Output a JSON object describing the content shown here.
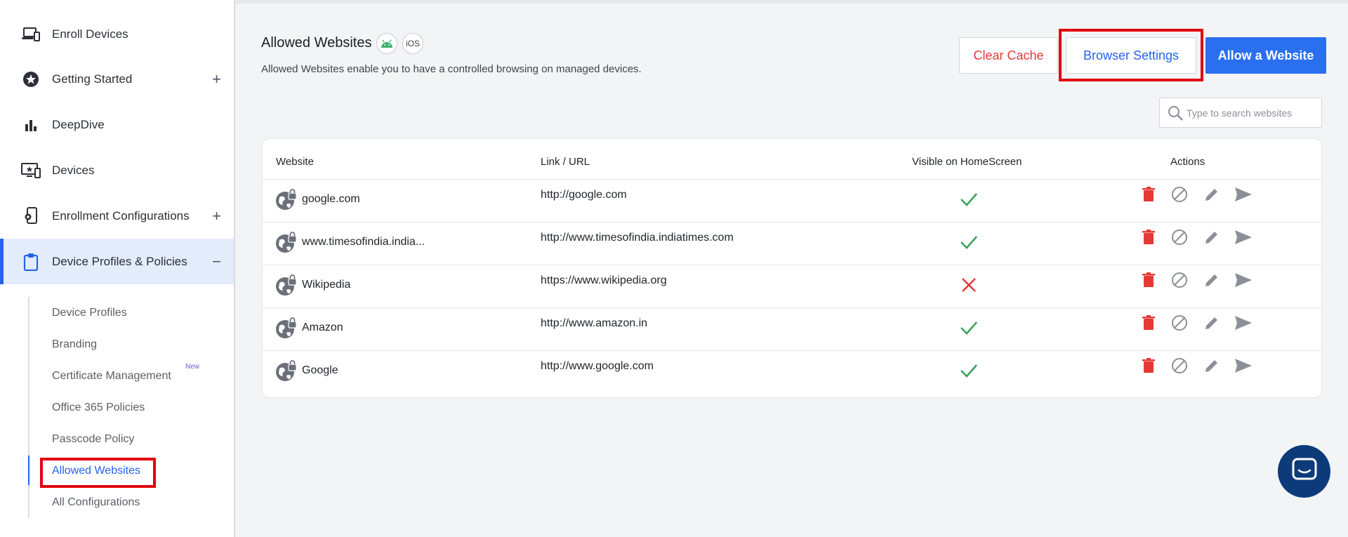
{
  "sidebar": {
    "items": [
      {
        "label": "Enroll Devices",
        "icon": "devices-icon",
        "toggle": ""
      },
      {
        "label": "Getting Started",
        "icon": "star-badge-icon",
        "toggle": "+"
      },
      {
        "label": "DeepDive",
        "icon": "bar-chart-icon",
        "toggle": ""
      },
      {
        "label": "Devices",
        "icon": "monitor-icon",
        "toggle": ""
      },
      {
        "label": "Enrollment Configurations",
        "icon": "phone-config-icon",
        "toggle": "+"
      },
      {
        "label": "Device Profiles & Policies",
        "icon": "clipboard-icon",
        "toggle": "−"
      }
    ],
    "sub_items": [
      {
        "label": "Device Profiles"
      },
      {
        "label": "Branding"
      },
      {
        "label": "Certificate Management",
        "badge": "New"
      },
      {
        "label": "Office 365 Policies"
      },
      {
        "label": "Passcode Policy"
      },
      {
        "label": "Allowed Websites"
      },
      {
        "label": "All Configurations"
      }
    ]
  },
  "header": {
    "title": "Allowed Websites",
    "ios_badge": "iOS",
    "subtitle": "Allowed Websites enable you to have a controlled browsing on managed devices."
  },
  "toolbar": {
    "clear_cache": "Clear Cache",
    "browser_settings": "Browser Settings",
    "allow_website": "Allow a Website"
  },
  "search": {
    "placeholder": "Type to search websites"
  },
  "table": {
    "columns": [
      "Website",
      "Link / URL",
      "Visible on HomeScreen",
      "Actions"
    ],
    "rows": [
      {
        "website": "google.com",
        "url": "http://google.com",
        "visible": true
      },
      {
        "website": "www.timesofindia.india...",
        "url": "http://www.timesofindia.indiatimes.com",
        "visible": true
      },
      {
        "website": "Wikipedia",
        "url": "https://www.wikipedia.org",
        "visible": false
      },
      {
        "website": "Amazon",
        "url": "http://www.amazon.in",
        "visible": true
      },
      {
        "website": "Google",
        "url": "http://www.google.com",
        "visible": true
      }
    ]
  },
  "colors": {
    "accent": "#2a6ff0",
    "danger": "#e53935",
    "success": "#3aa35b",
    "highlight_box": "#e3000f"
  }
}
